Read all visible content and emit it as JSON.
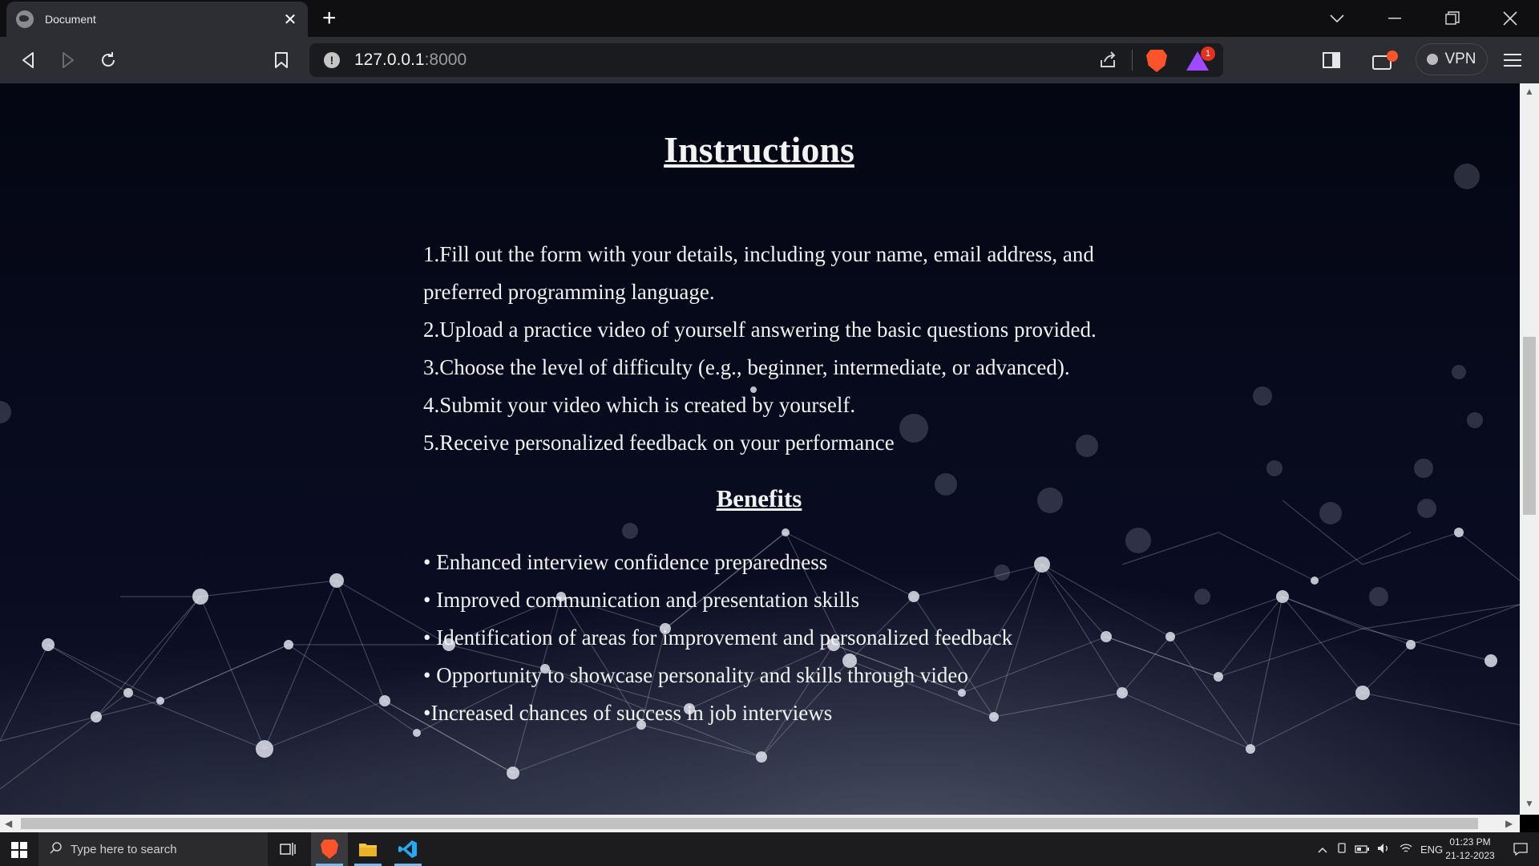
{
  "browser": {
    "tab_title": "Document",
    "new_tab_label": "+",
    "url_host": "127.0.0.1",
    "url_port": ":8000",
    "rewards_badge": "1",
    "vpn_label": "VPN"
  },
  "page": {
    "heading": "Instructions",
    "steps": [
      "1.Fill out the form with your details, including your name, email address, and preferred programming language.",
      "2.Upload a practice video of yourself answering the basic questions provided.",
      "3.Choose the level of difficulty (e.g., beginner, intermediate, or advanced).",
      "4.Submit your video which is created by yourself.",
      "5.Receive personalized feedback on your performance"
    ],
    "benefits_heading": "Benefits",
    "benefits": [
      "• Enhanced interview confidence preparedness",
      "• Improved communication and presentation skills",
      "• Identification of areas for improvement and personalized feedback",
      "• Opportunity to showcase personality and skills through video",
      "•Increased chances of success in job interviews"
    ]
  },
  "taskbar": {
    "search_placeholder": "Type here to search",
    "language": "ENG",
    "time": "01:23 PM",
    "date": "21-12-2023"
  },
  "colors": {
    "chrome_dark": "#0f0f12",
    "toolbar": "#2d2e33",
    "page_bg": "#070a1c",
    "brave_orange": "#fb542b",
    "vscode_blue": "#23a9f2"
  },
  "icons": [
    "globe-icon",
    "close-icon",
    "plus-icon",
    "chevron-down-icon",
    "minimize-icon",
    "restore-icon",
    "back-icon",
    "forward-icon",
    "reload-icon",
    "bookmark-icon",
    "info-icon",
    "share-icon",
    "brave-shields-icon",
    "brave-rewards-icon",
    "sidebar-icon",
    "wallet-icon",
    "menu-icon",
    "windows-start-icon",
    "search-icon",
    "task-view-icon",
    "brave-app-icon",
    "file-explorer-icon",
    "vscode-icon",
    "notification-icon"
  ]
}
